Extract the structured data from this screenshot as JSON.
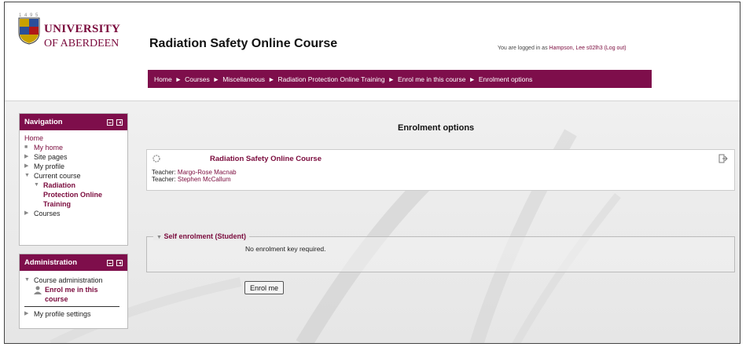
{
  "logo": {
    "line1": "UNIVERSITY",
    "line2": "OF ABERDEEN",
    "dots": "1 4 9 5"
  },
  "header": {
    "site_title": "Radiation Safety Online Course",
    "login_prefix": "You are logged in as ",
    "login_user": "Hampson, Lee s02lh3",
    "logout": "(Log out)"
  },
  "breadcrumb": {
    "items": [
      "Home",
      "Courses",
      "Miscellaneous",
      "Radiation Protection Online Training",
      "Enrol me in this course",
      "Enrolment options"
    ],
    "separator": "►"
  },
  "navigation": {
    "title": "Navigation",
    "home": "Home",
    "my_home": "My home",
    "site_pages": "Site pages",
    "my_profile": "My profile",
    "current_course": "Current course",
    "course_line1": "Radiation",
    "course_line2": "Protection Online",
    "course_line3": "Training",
    "courses": "Courses"
  },
  "administration": {
    "title": "Administration",
    "course_admin": "Course administration",
    "enrol_line1": "Enrol me in this",
    "enrol_line2": "course",
    "profile_settings": "My profile settings"
  },
  "main": {
    "title": "Enrolment options",
    "course_name": "Radiation Safety Online Course",
    "teacher_label": "Teacher:",
    "teacher1": "Margo-Rose Macnab",
    "teacher2": "Stephen McCallum",
    "self_enrol_legend": "Self enrolment (Student)",
    "no_key": "No enrolment key required.",
    "enrol_button": "Enrol me"
  },
  "colors": {
    "brand": "#7e0e4b",
    "link": "#7a0a3c"
  },
  "icons": [
    "crest-icon",
    "minimize-icon",
    "dock-icon",
    "bullet-icon",
    "expand-icon",
    "collapse-icon",
    "user-icon",
    "course-icon",
    "login-icon"
  ]
}
